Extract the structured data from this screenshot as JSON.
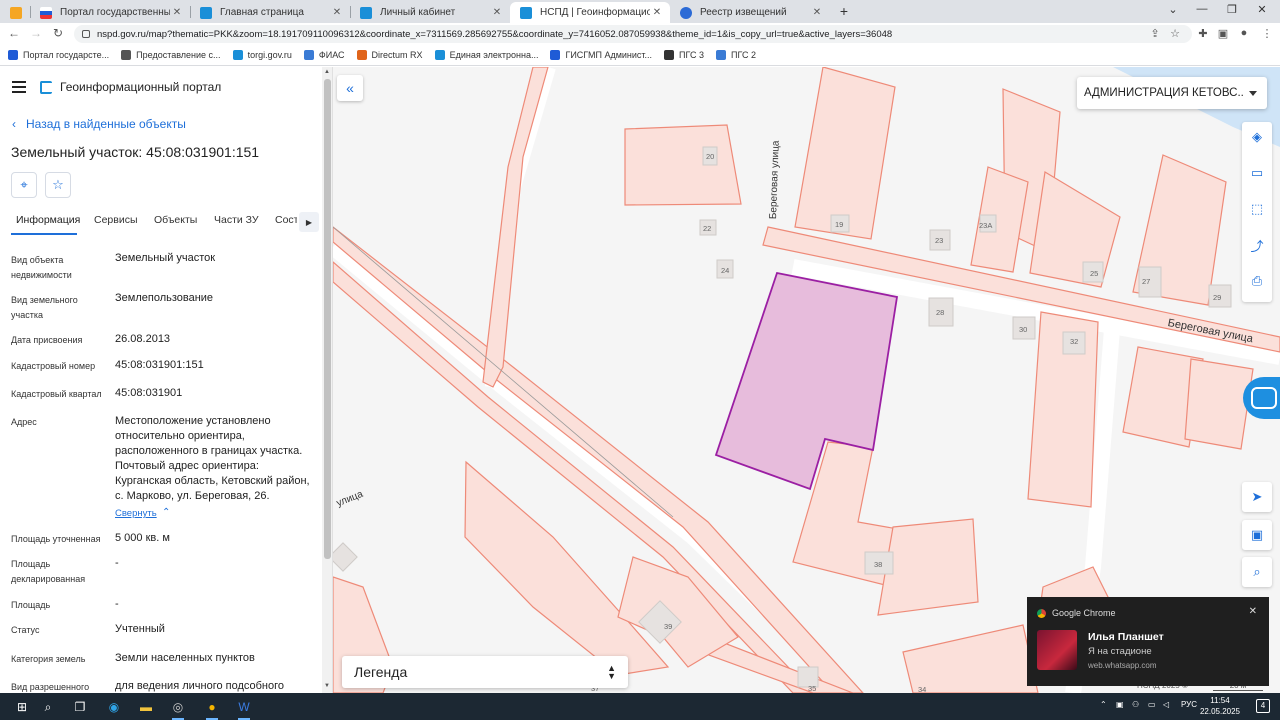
{
  "browser": {
    "tabs": [
      {
        "title": "",
        "favicon_color": "#f5a623"
      },
      {
        "title": "Портал государственных услуг",
        "favicon_color": "#1f5bd6"
      },
      {
        "title": "Главная страница",
        "favicon_color": "#1a8fd8"
      },
      {
        "title": "Личный кабинет",
        "favicon_color": "#1a8fd8"
      },
      {
        "title": "НСПД | Геоинформационный п",
        "favicon_color": "#1a8fd8"
      },
      {
        "title": "Реестр извещений",
        "favicon_color": "#2b6ad6"
      }
    ],
    "new_tab": "+",
    "url": "nspd.gov.ru/map?thematic=PKK&zoom=18.191709110096312&coordinate_x=7311569.285692755&coordinate_y=7416052.087059938&theme_id=1&is_copy_url=true&active_layers=36048",
    "bookmarks": [
      {
        "label": "Портал государсте...",
        "color": "#1f5bd6"
      },
      {
        "label": "Предоставление с...",
        "color": "#555555"
      },
      {
        "label": "torgi.gov.ru",
        "color": "#1a8fd8"
      },
      {
        "label": "ФИАС",
        "color": "#3a7bd5"
      },
      {
        "label": "Directum RX",
        "color": "#e0641b"
      },
      {
        "label": "Единая электронна...",
        "color": "#1a8fd8"
      },
      {
        "label": "ГИСГМП Админист...",
        "color": "#1f5bd6"
      },
      {
        "label": "ПГС 3",
        "color": "#333333"
      },
      {
        "label": "ПГС 2",
        "color": "#3a7bd5"
      }
    ]
  },
  "panel": {
    "brand": "Геоинформационный портал",
    "back_label": "Назад в найденные объекты",
    "title": "Земельный участок: 45:08:031901:151",
    "tabs": [
      "Информация",
      "Сервисы",
      "Объекты",
      "Части ЗУ",
      "Соста"
    ],
    "attributes": [
      {
        "label": "Вид объекта недвижимости",
        "value": "Земельный участок"
      },
      {
        "label": "Вид земельного участка",
        "value": "Землепользование"
      },
      {
        "label": "Дата присвоения",
        "value": "26.08.2013"
      },
      {
        "label": "Кадастровый номер",
        "value": "45:08:031901:151"
      },
      {
        "label": "Кадастровый квартал",
        "value": "45:08:031901"
      },
      {
        "label": "Адрес",
        "value": "Местоположение установлено относительно ориентира, расположенного в границах участка. Почтовый адрес ориентира: Курганская область, Кетовский район, с. Марково, ул. Береговая, 26."
      },
      {
        "label": "Площадь уточненная",
        "value": "5 000 кв. м"
      },
      {
        "label": "Площадь декларированная",
        "value": "-"
      },
      {
        "label": "Площадь",
        "value": "-"
      },
      {
        "label": "Статус",
        "value": "Учтенный"
      },
      {
        "label": "Категория земель",
        "value": "Земли населенных пунктов"
      },
      {
        "label": "Вид разрешенного",
        "value": "для ведения личного подсобного"
      }
    ],
    "collapse_label": "Свернуть"
  },
  "map": {
    "admin_select": "АДМИНИСТРАЦИЯ КЕТОВС...",
    "legend_label": "Легенда",
    "copyright": "НСПД 2025 ©",
    "scale": "20 м",
    "streets": [
      "Береговая улица",
      "Береговая улица",
      "улица"
    ],
    "house_numbers": [
      "20",
      "22",
      "24",
      "19",
      "23",
      "23А",
      "25",
      "27",
      "29",
      "28",
      "30",
      "32",
      "38",
      "39",
      "37",
      "35",
      "34"
    ],
    "colors": {
      "parcel_fill": "#fbe0da",
      "parcel_stroke": "#ee8a78",
      "selected_fill": "#e7bcdc",
      "selected_stroke": "#9b1fa3",
      "water": "#cfe4f7",
      "accent": "#1e6fd9"
    }
  },
  "notification": {
    "app": "Google Chrome",
    "title": "Илья Планшет",
    "body": "Я на стадионе",
    "source": "web.whatsapp.com"
  },
  "taskbar": {
    "lang": "РУС",
    "time": "11:54",
    "date": "22.05.2025",
    "notif_count": "4"
  }
}
